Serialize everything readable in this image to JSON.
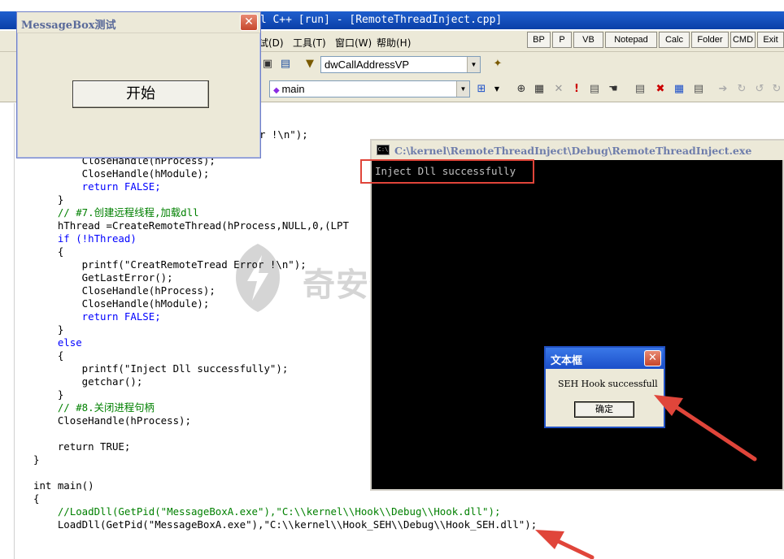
{
  "ide": {
    "title": "al C++ [run] - [RemoteThreadInject.cpp]",
    "menu": [
      "试(D)",
      "工具(T)",
      "窗口(W)",
      "帮助(H)"
    ],
    "tool_buttons": [
      "BP",
      "P",
      "VB",
      "Notepad",
      "Calc",
      "Folder",
      "CMD",
      "Exit"
    ],
    "member_combo": "dwCallAddressVP",
    "function_combo": "main"
  },
  "code_lines": [
    "r !\\n\");",
    "        CloseHandle(hProcess);",
    "        CloseHandle(hModule);",
    "        return FALSE;",
    "    }",
    "    // #7.创建远程线程,加载dll",
    "    hThread =CreateRemoteThread(hProcess,NULL,0,(LPT",
    "    if (!hThread)",
    "    {",
    "        printf(\"CreatRemoteTread Error !\\n\");",
    "        GetLastError();",
    "        CloseHandle(hProcess);",
    "        CloseHandle(hModule);",
    "        return FALSE;",
    "    }",
    "    else",
    "    {",
    "        printf(\"Inject Dll successfully\");",
    "        getchar();",
    "    }",
    "    // #8.关闭进程句柄",
    "    CloseHandle(hProcess);",
    "",
    "    return TRUE;",
    "}",
    "",
    "int main()",
    "{",
    "    //LoadDll(GetPid(\"MessageBoxA.exe\"),\"C:\\\\kernel\\\\Hook\\\\Debug\\\\Hook.dll\");",
    "    LoadDll(GetPid(\"MessageBoxA.exe\"),\"C:\\\\kernel\\\\Hook_SEH\\\\Debug\\\\Hook_SEH.dll\");"
  ],
  "msgbox_window": {
    "title": "MessageBox测试",
    "start_button": "开始"
  },
  "console": {
    "title": "C:\\kernel\\RemoteThreadInject\\Debug\\RemoteThreadInject.exe",
    "output": "Inject Dll successfully"
  },
  "textbox_dialog": {
    "title": "文本框",
    "message": "SEH Hook successfull",
    "ok_button": "确定"
  },
  "watermark": "奇安信攻防社区",
  "colors": {
    "annotation_red": "#e0453a",
    "titlebar_blue": "#0a3fa8",
    "keyword": "#0000ff",
    "comment": "#008000"
  }
}
